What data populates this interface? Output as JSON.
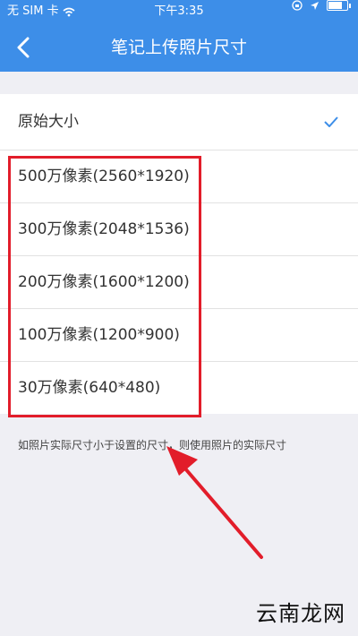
{
  "status_bar": {
    "carrier": "无 SIM 卡",
    "time": "下午3:35"
  },
  "nav": {
    "title": "笔记上传照片尺寸"
  },
  "options": [
    {
      "label": "原始大小",
      "selected": true
    },
    {
      "label": "500万像素(2560*1920)",
      "selected": false
    },
    {
      "label": "300万像素(2048*1536)",
      "selected": false
    },
    {
      "label": "200万像素(1600*1200)",
      "selected": false
    },
    {
      "label": "100万像素(1200*900)",
      "selected": false
    },
    {
      "label": "30万像素(640*480)",
      "selected": false
    }
  ],
  "footnote": "如照片实际尺寸小于设置的尺寸，则使用照片的实际尺寸",
  "watermark": "云南龙网",
  "colors": {
    "header": "#3d8ee8",
    "check": "#3d8ee8",
    "highlight": "#e21d2a"
  }
}
